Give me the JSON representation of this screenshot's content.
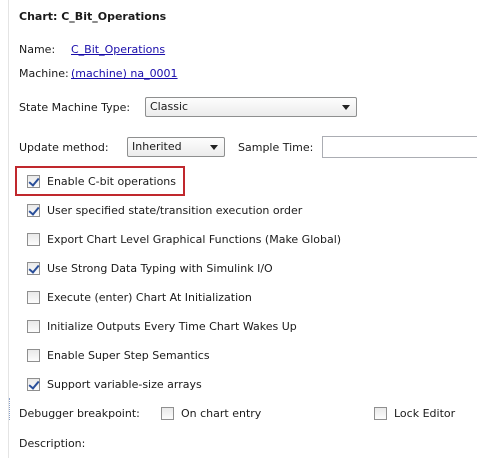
{
  "chart_title": "Chart: C_Bit_Operations",
  "name": {
    "label": "Name:",
    "value": "C_Bit_Operations"
  },
  "machine": {
    "label": "Machine:",
    "value": "(machine) na_0001"
  },
  "state_machine_type": {
    "label": "State Machine Type:",
    "value": "Classic"
  },
  "update_method": {
    "label": "Update method:",
    "value": "Inherited"
  },
  "sample_time": {
    "label": "Sample Time:",
    "value": ""
  },
  "options": [
    {
      "label": "Enable C-bit operations",
      "checked": true
    },
    {
      "label": "User specified state/transition execution order",
      "checked": true
    },
    {
      "label": "Export Chart Level Graphical Functions (Make Global)",
      "checked": false
    },
    {
      "label": "Use Strong Data Typing with Simulink I/O",
      "checked": true
    },
    {
      "label": "Execute (enter) Chart At Initialization",
      "checked": false
    },
    {
      "label": "Initialize Outputs Every Time Chart Wakes Up",
      "checked": false
    },
    {
      "label": "Enable Super Step Semantics",
      "checked": false
    },
    {
      "label": "Support variable-size arrays",
      "checked": true
    }
  ],
  "debugger": {
    "label": "Debugger breakpoint:",
    "on_chart_entry_label": "On chart entry",
    "on_chart_entry_checked": false,
    "lock_editor_label": "Lock Editor",
    "lock_editor_checked": false
  },
  "description_label": "Description:",
  "colors": {
    "highlight_border": "#c0282d",
    "link": "#1a0dab"
  }
}
